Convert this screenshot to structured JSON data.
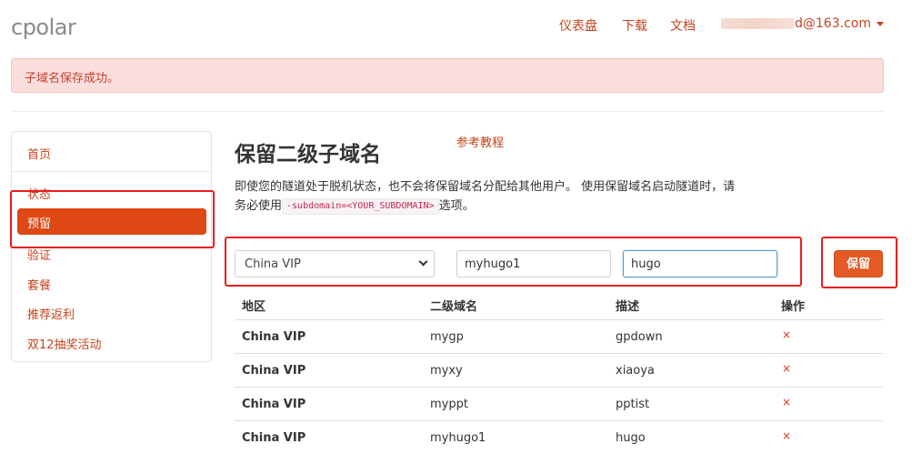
{
  "header": {
    "logo": "cpolar",
    "nav": {
      "dashboard": "仪表盘",
      "download": "下载",
      "docs": "文档"
    },
    "account": "d@163.com"
  },
  "alert": {
    "message": "子域名保存成功。"
  },
  "sidebar": {
    "items": [
      {
        "label": "首页"
      },
      {
        "label": "状态"
      },
      {
        "label": "预留"
      },
      {
        "label": "验证"
      },
      {
        "label": "套餐"
      },
      {
        "label": "推荐返利"
      },
      {
        "label": "双12抽奖活动"
      }
    ]
  },
  "main": {
    "title": "保留二级子域名",
    "ref_link": "参考教程",
    "desc_part1": "即使您的隧道处于脱机状态，也不会将保留域名分配给其他用户。 使用保留域名启动隧道时，请务必使用",
    "desc_code": "-subdomain=<YOUR_SUBDOMAIN>",
    "desc_part2": "选项。"
  },
  "form": {
    "region_selected": "China VIP",
    "subdomain_value": "myhugo1",
    "description_value": "hugo",
    "save_label": "保留"
  },
  "table": {
    "headers": [
      "地区",
      "二级域名",
      "描述",
      "操作"
    ],
    "rows": [
      {
        "region": "China VIP",
        "subdomain": "mygp",
        "description": "gpdown",
        "action": "×"
      },
      {
        "region": "China VIP",
        "subdomain": "myxy",
        "description": "xiaoya",
        "action": "×"
      },
      {
        "region": "China VIP",
        "subdomain": "myppt",
        "description": "pptist",
        "action": "×"
      },
      {
        "region": "China VIP",
        "subdomain": "myhugo1",
        "description": "hugo",
        "action": "×"
      }
    ]
  },
  "colors": {
    "accent": "#dd4814",
    "link": "#c7421b",
    "alert_bg": "#f9dedc",
    "annotation": "#ea1c1c"
  }
}
